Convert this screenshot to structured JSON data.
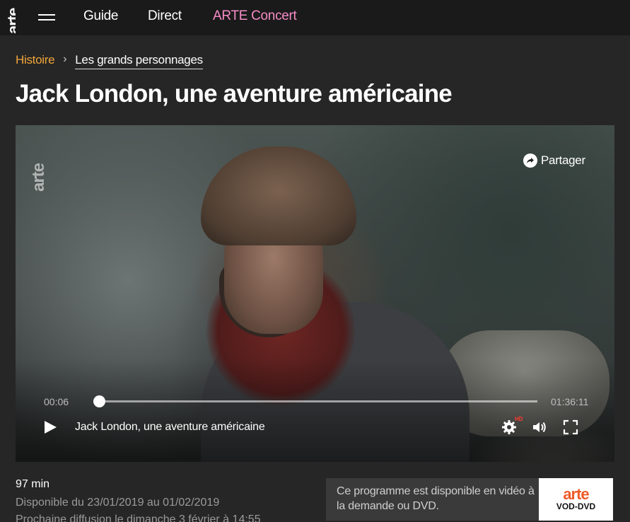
{
  "header": {
    "logo": "arte",
    "menu_icon": "hamburger-icon",
    "nav": [
      {
        "label": "Guide"
      },
      {
        "label": "Direct"
      },
      {
        "label": "ARTE Concert",
        "color": "#f58cc6"
      }
    ]
  },
  "breadcrumb": {
    "items": [
      "Histoire",
      "Les grands personnages"
    ],
    "separator": "›",
    "accent": "#f0a63a"
  },
  "page": {
    "title": "Jack London, une aventure américaine"
  },
  "player": {
    "watermark": "arte",
    "share_label": "Partager",
    "time_current": "00:06",
    "time_total": "01:36:11",
    "progress": 0.001,
    "title": "Jack London, une aventure américaine",
    "hd_badge": "HD",
    "icons": [
      "play-icon",
      "settings-icon",
      "volume-icon",
      "fullscreen-icon",
      "share-icon"
    ]
  },
  "info": {
    "duration": "97 min",
    "availability": "Disponible du 23/01/2019 au 01/02/2019",
    "next_broadcast": "Prochaine diffusion le dimanche 3 février à 14:55"
  },
  "vod": {
    "text": "Ce programme est disponible en vidéo à la demande ou DVD.",
    "logo_brand": "arte",
    "logo_sub": "VOD-DVD",
    "brand_color": "#f05a28"
  }
}
